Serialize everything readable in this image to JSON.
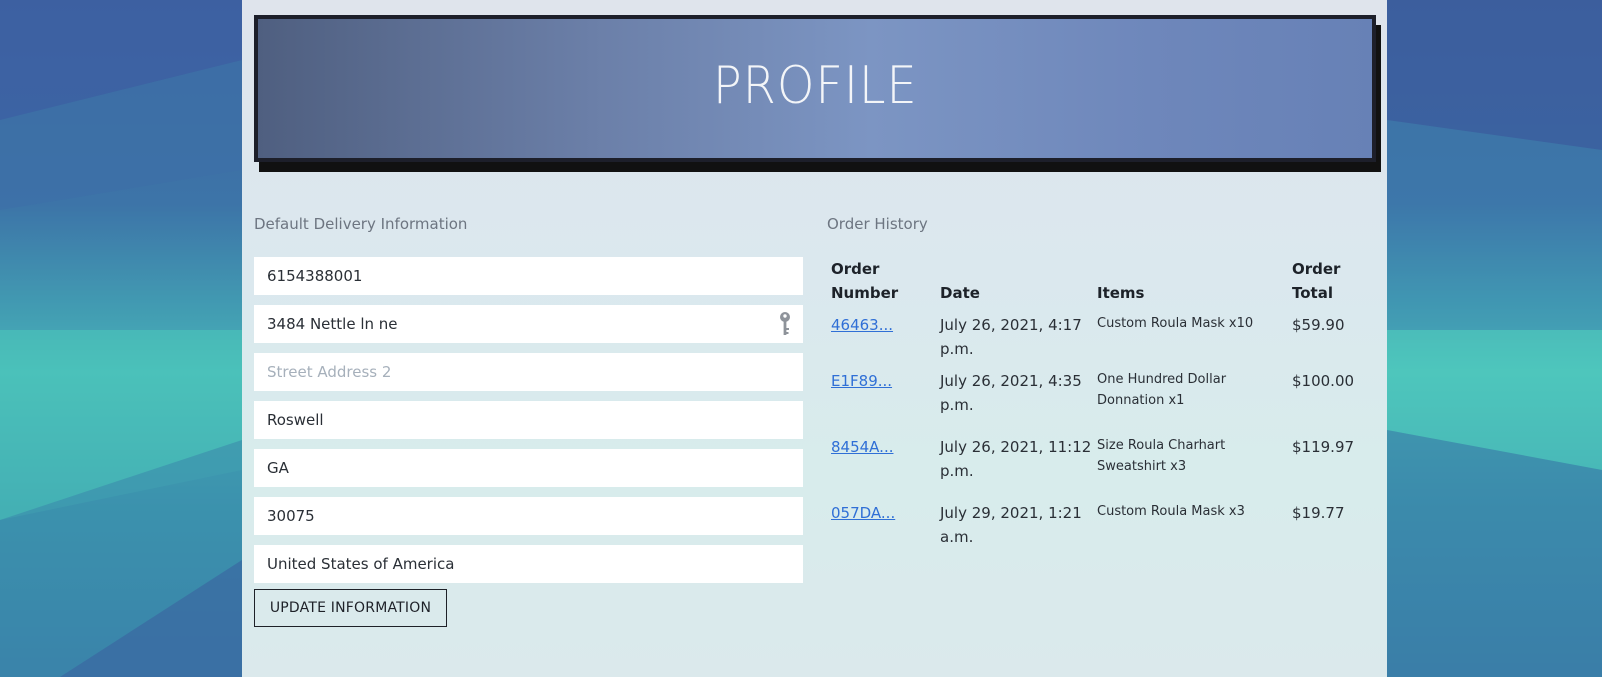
{
  "banner": {
    "title": "PROFILE"
  },
  "delivery": {
    "section_title": "Default Delivery Information",
    "fields": [
      {
        "name": "phone",
        "value": "6154388001",
        "placeholder": ""
      },
      {
        "name": "street1",
        "value": "3484 Nettle ln ne",
        "placeholder": ""
      },
      {
        "name": "street2",
        "value": "",
        "placeholder": "Street Address 2"
      },
      {
        "name": "city",
        "value": "Roswell",
        "placeholder": ""
      },
      {
        "name": "state",
        "value": "GA",
        "placeholder": ""
      },
      {
        "name": "postcode",
        "value": "30075",
        "placeholder": ""
      },
      {
        "name": "country",
        "value": "United States of America",
        "placeholder": ""
      }
    ],
    "update_label": "UPDATE INFORMATION"
  },
  "orders": {
    "section_title": "Order History",
    "headers": {
      "number_line1": "Order",
      "number_line2": "Number",
      "date": "Date",
      "items": "Items",
      "total_line1": "Order",
      "total_line2": "Total"
    },
    "rows": [
      {
        "number": "46463...",
        "date_line1": "July 26, 2021, 4:17",
        "date_line2": "p.m.",
        "items_line1": "Custom Roula Mask x10",
        "items_line2": "",
        "total": "$59.90"
      },
      {
        "number": "E1F89...",
        "date_line1": "July 26, 2021, 4:35",
        "date_line2": "p.m.",
        "items_line1": "One Hundred Dollar",
        "items_line2": "Donnation x1",
        "total": "$100.00"
      },
      {
        "number": "8454A...",
        "date_line1": "July 26, 2021, 11:12",
        "date_line2": "p.m.",
        "items_line1": "Size Roula Charhart",
        "items_line2": "Sweatshirt x3",
        "total": "$119.97"
      },
      {
        "number": "057DA...",
        "date_line1": "July 29, 2021, 1:21",
        "date_line2": "a.m.",
        "items_line1": "Custom Roula Mask x3",
        "items_line2": "",
        "total": "$19.77"
      }
    ]
  },
  "icons": {
    "autofill": "key-icon"
  },
  "colors": {
    "link": "#2f6fd6",
    "banner_text": "#f3f5f8",
    "panel": "#dbe8ee"
  }
}
